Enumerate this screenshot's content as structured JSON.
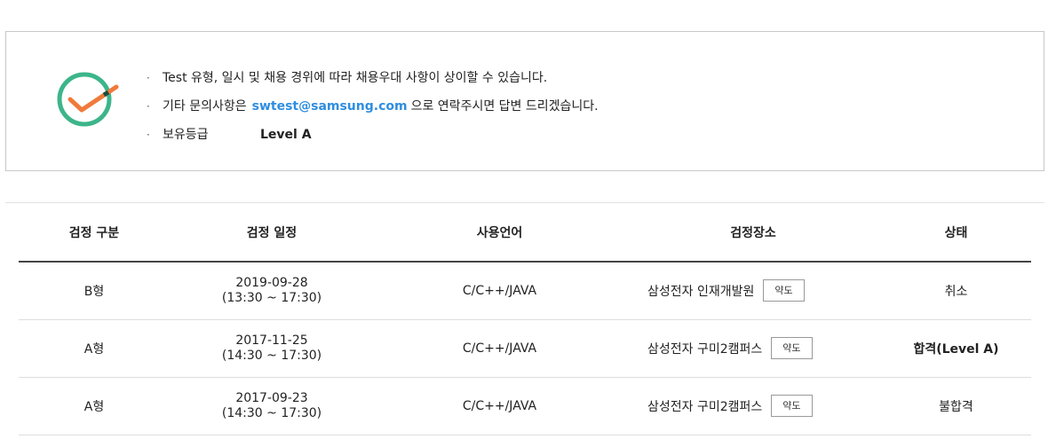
{
  "notice": {
    "line1": "Test 유형, 일시 및 채용 경위에 따라 채용우대 사항이 상이할 수 있습니다.",
    "line2_prefix": "기타 문의사항은",
    "line2_email": "swtest@samsung.com",
    "line2_suffix": "으로 연락주시면 답변 드리겠습니다.",
    "level_label": "보유등급",
    "level_value": "Level A",
    "icon": "check-circle-icon"
  },
  "table": {
    "headers": [
      "검정 구분",
      "검정 일정",
      "사용언어",
      "검정장소",
      "상태"
    ],
    "rows": [
      {
        "type": "B형",
        "date": "2019-09-28",
        "time": "(13:30 ~ 17:30)",
        "language": "C/C++/JAVA",
        "place": "삼성전자 인재개발원",
        "map_label": "약도",
        "status": "취소"
      },
      {
        "type": "A형",
        "date": "2017-11-25",
        "time": "(14:30 ~ 17:30)",
        "language": "C/C++/JAVA",
        "place": "삼성전자 구미2캠퍼스",
        "map_label": "약도",
        "status": "합격(Level A)"
      },
      {
        "type": "A형",
        "date": "2017-09-23",
        "time": "(14:30 ~ 17:30)",
        "language": "C/C++/JAVA",
        "place": "삼성전자 구미2캠퍼스",
        "map_label": "약도",
        "status": "불합격"
      }
    ]
  },
  "colors": {
    "check_circle": "#3cb58a",
    "check_mark": "#f07a3a",
    "email": "#2f8ee0"
  }
}
